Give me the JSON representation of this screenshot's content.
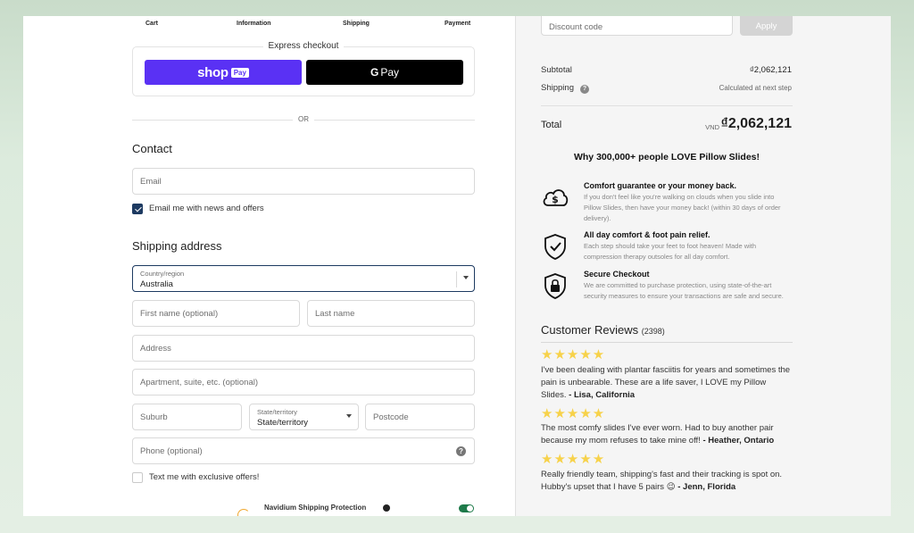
{
  "steps": [
    "Cart",
    "Information",
    "Shipping",
    "Payment"
  ],
  "express": {
    "label": "Express checkout",
    "shop_word": "shop",
    "shop_pay": "Pay",
    "gpay_g": "G",
    "gpay_text": "Pay"
  },
  "or_text": "OR",
  "contact": {
    "title": "Contact",
    "email_placeholder": "Email",
    "news_label": "Email me with news and offers"
  },
  "shipping": {
    "title": "Shipping address",
    "country_label": "Country/region",
    "country_value": "Australia",
    "first_name": "First name (optional)",
    "last_name": "Last name",
    "address": "Address",
    "apartment": "Apartment, suite, etc. (optional)",
    "suburb": "Suburb",
    "state_label": "State/territory",
    "state_value": "State/territory",
    "postcode": "Postcode",
    "phone": "Phone (optional)",
    "phone_help": "?",
    "sms_label": "Text me with exclusive offers!",
    "protection_label": "Navidium Shipping Protection"
  },
  "summary": {
    "discount_placeholder": "Discount code",
    "apply_label": "Apply",
    "subtotal_label": "Subtotal",
    "subtotal_value": "₫2,062,121",
    "shipping_label": "Shipping",
    "shipping_help": "?",
    "shipping_value": "Calculated at next step",
    "total_label": "Total",
    "currency": "VND",
    "total_value": "₫2,062,121"
  },
  "why_title": "Why 300,000+ people LOVE Pillow Slides!",
  "benefits": [
    {
      "icon": "cloud-dollar-icon",
      "title": "Comfort guarantee or your money back.",
      "text": "If you don't feel like you're walking on clouds when you slide into Pillow Slides, then have your money back! (within 30 days of order delivery)."
    },
    {
      "icon": "shield-check-icon",
      "title": "All day comfort & foot pain relief.",
      "text": "Each step should take your feet to foot heaven! Made with compression therapy outsoles for all day comfort."
    },
    {
      "icon": "lock-shield-icon",
      "title": "Secure Checkout",
      "text": "We are committed to purchase protection, using state-of-the-art security measures to ensure your transactions are safe and secure."
    }
  ],
  "reviews": {
    "title": "Customer Reviews",
    "count": "(2398)",
    "items": [
      {
        "stars": "★★★★★",
        "text": "I've been dealing with plantar fasciitis for years and sometimes the pain is unbearable. These are a life saver, I LOVE my Pillow Slides.",
        "author": "- Lisa, California"
      },
      {
        "stars": "★★★★★",
        "text": "The most comfy slides I've ever worn. Had to buy another pair because my mom refuses to take mine off!",
        "author": "- Heather, Ontario"
      },
      {
        "stars": "★★★★★",
        "text": "Really friendly team, shipping's fast and their tracking is spot on. Hubby's upset that I have 5 pairs 😉",
        "author": "- Jenn, Florida"
      }
    ]
  },
  "colors": {
    "shop_pay": "#5a31f4",
    "accent_navy": "#1d3a61",
    "star": "#f7d24a",
    "toggle_on": "#1e7a4a"
  }
}
